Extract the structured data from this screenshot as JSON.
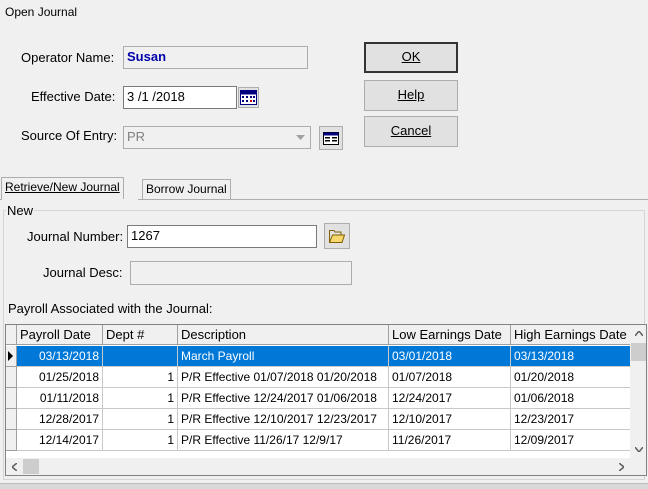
{
  "window": {
    "title": "Open Journal"
  },
  "form": {
    "operator_label": "Operator Name:",
    "operator_value": "Susan",
    "effective_label": "Effective Date:",
    "effective_value": "3 /1 /2018",
    "source_label": "Source Of Entry:",
    "source_value": "PR"
  },
  "buttons": {
    "ok": "OK",
    "help": "Help",
    "cancel": "Cancel"
  },
  "tabs": [
    {
      "label": "Retrieve/New Journal",
      "active": true
    },
    {
      "label": "Borrow Journal",
      "active": false
    }
  ],
  "new_group": {
    "legend": "New",
    "journal_number_label": "Journal Number:",
    "journal_number_value": "1267",
    "journal_desc_label": "Journal Desc:",
    "journal_desc_value": "",
    "payroll_caption": "Payroll Associated with the Journal:"
  },
  "table": {
    "columns": [
      "Payroll Date",
      "Dept #",
      "Description",
      "Low Earnings Date",
      "High Earnings Date"
    ],
    "rows": [
      {
        "payroll_date": "03/13/2018",
        "dept": "",
        "description": "March Payroll",
        "low": "03/01/2018",
        "high": "03/13/2018",
        "selected": true
      },
      {
        "payroll_date": "01/25/2018",
        "dept": "1",
        "description": "P/R Effective 01/07/2018 01/20/2018",
        "low": "01/07/2018",
        "high": "01/20/2018",
        "selected": false
      },
      {
        "payroll_date": "01/11/2018",
        "dept": "1",
        "description": "P/R Effective 12/24/2017 01/06/2018",
        "low": "12/24/2017",
        "high": "01/06/2018",
        "selected": false
      },
      {
        "payroll_date": "12/28/2017",
        "dept": "1",
        "description": "P/R Effective 12/10/2017 12/23/2017",
        "low": "12/10/2017",
        "high": "12/23/2017",
        "selected": false
      },
      {
        "payroll_date": "12/14/2017",
        "dept": "1",
        "description": "P/R Effective 11/26/17 12/9/17",
        "low": "11/26/2017",
        "high": "12/09/2017",
        "selected": false
      }
    ]
  },
  "colors": {
    "selection": "#0078d7",
    "operator_text": "#0000aa"
  }
}
